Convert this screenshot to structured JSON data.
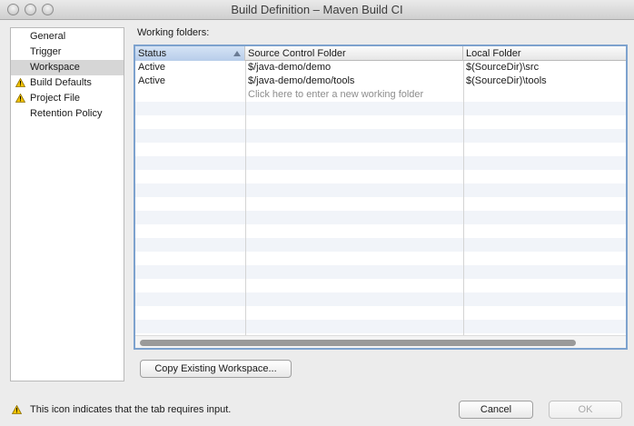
{
  "window": {
    "title": "Build Definition – Maven Build CI"
  },
  "sidebar": {
    "items": [
      {
        "label": "General",
        "warning": false,
        "selected": false
      },
      {
        "label": "Trigger",
        "warning": false,
        "selected": false
      },
      {
        "label": "Workspace",
        "warning": false,
        "selected": true
      },
      {
        "label": "Build Defaults",
        "warning": true,
        "selected": false
      },
      {
        "label": "Project File",
        "warning": true,
        "selected": false
      },
      {
        "label": "Retention Policy",
        "warning": false,
        "selected": false
      }
    ]
  },
  "workspace": {
    "section_label": "Working folders:",
    "columns": [
      "Status",
      "Source Control Folder",
      "Local Folder"
    ],
    "sorted_column": "Status",
    "rows": [
      {
        "status": "Active",
        "source": "$/java-demo/demo",
        "local": "$(SourceDir)\\src"
      },
      {
        "status": "Active",
        "source": "$/java-demo/demo/tools",
        "local": "$(SourceDir)\\tools"
      }
    ],
    "new_row_placeholder": "Click here to enter a new working folder",
    "copy_button": "Copy Existing Workspace..."
  },
  "footer": {
    "note": "This icon indicates that the tab requires input.",
    "cancel_label": "Cancel",
    "ok_label": "OK"
  },
  "colors": {
    "warning": "#f2c200",
    "selection": "#d6d6d6",
    "focus_border": "#7da2ce"
  }
}
